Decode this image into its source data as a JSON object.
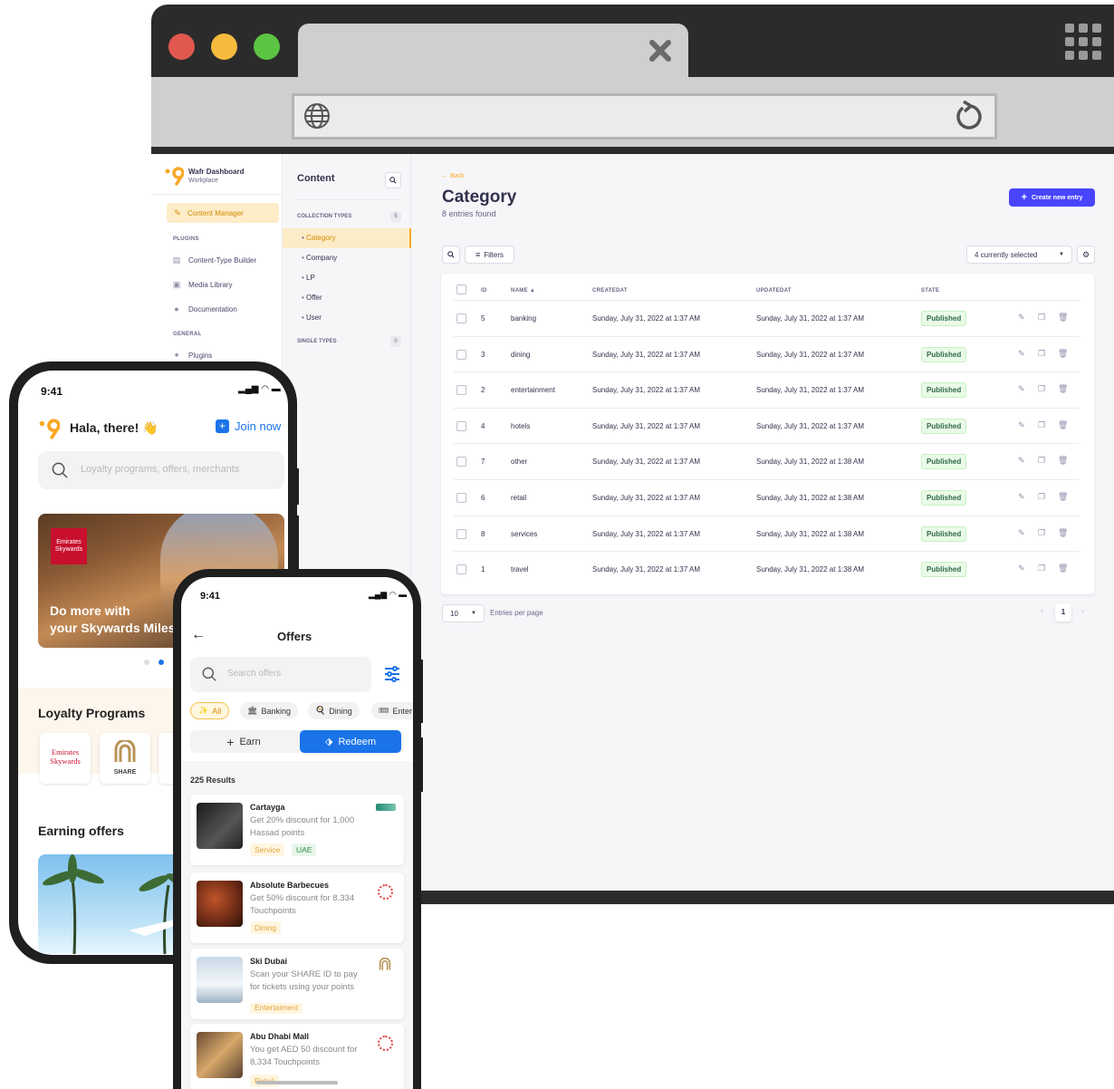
{
  "browser": {
    "address": ""
  },
  "cms": {
    "brand_title": "Wafr Dashboard",
    "brand_subtitle": "Workplace",
    "content_manager": "Content Manager",
    "plugins_heading": "PLUGINS",
    "plugins": [
      "Content-Type Builder",
      "Media Library",
      "Documentation"
    ],
    "general_heading": "GENERAL",
    "general": [
      "Plugins"
    ],
    "subnav_title": "Content",
    "collection_types_label": "COLLECTION TYPES",
    "collection_types_count": "5",
    "collection_types": [
      "Category",
      "Company",
      "LP",
      "Offer",
      "User"
    ],
    "single_types_label": "SINGLE TYPES",
    "single_types_count": "0",
    "back": "Back",
    "page_title": "Category",
    "entries_found": "8 entries found",
    "create_button": "Create new entry",
    "filters": "Filters",
    "selected": "4 currently selected",
    "columns": [
      "ID",
      "NAME",
      "CREATEDAT",
      "UPDATEDAT",
      "STATE"
    ],
    "rows": [
      {
        "id": "5",
        "name": "banking",
        "created": "Sunday, July 31, 2022 at 1:37 AM",
        "updated": "Sunday, July 31, 2022 at 1:37 AM",
        "state": "Published"
      },
      {
        "id": "3",
        "name": "dining",
        "created": "Sunday, July 31, 2022 at 1:37 AM",
        "updated": "Sunday, July 31, 2022 at 1:37 AM",
        "state": "Published"
      },
      {
        "id": "2",
        "name": "entertainment",
        "created": "Sunday, July 31, 2022 at 1:37 AM",
        "updated": "Sunday, July 31, 2022 at 1:37 AM",
        "state": "Published"
      },
      {
        "id": "4",
        "name": "hotels",
        "created": "Sunday, July 31, 2022 at 1:37 AM",
        "updated": "Sunday, July 31, 2022 at 1:37 AM",
        "state": "Published"
      },
      {
        "id": "7",
        "name": "other",
        "created": "Sunday, July 31, 2022 at 1:37 AM",
        "updated": "Sunday, July 31, 2022 at 1:38 AM",
        "state": "Published"
      },
      {
        "id": "6",
        "name": "retail",
        "created": "Sunday, July 31, 2022 at 1:37 AM",
        "updated": "Sunday, July 31, 2022 at 1:38 AM",
        "state": "Published"
      },
      {
        "id": "8",
        "name": "services",
        "created": "Sunday, July 31, 2022 at 1:37 AM",
        "updated": "Sunday, July 31, 2022 at 1:38 AM",
        "state": "Published"
      },
      {
        "id": "1",
        "name": "travel",
        "created": "Sunday, July 31, 2022 at 1:37 AM",
        "updated": "Sunday, July 31, 2022 at 1:38 AM",
        "state": "Published"
      }
    ],
    "page_size": "10",
    "entries_per_page": "Entries per page",
    "current_page": "1"
  },
  "phone1": {
    "time": "9:41",
    "greeting": "Hala, there! 👋",
    "join": "Join now",
    "search_placeholder": "Loyalty programs, offers, merchants",
    "banner_line1": "Do more with",
    "banner_line2": "your Skywards Miles",
    "emirates_logo_text": "Emirates Skywards",
    "loyalty_heading": "Loyalty Programs",
    "share_logo_text": "SHARE",
    "earning_heading": "Earning offers"
  },
  "phone2": {
    "time": "9:41",
    "title": "Offers",
    "search_placeholder": "Search offers",
    "chips": [
      "All",
      "Banking",
      "Dining",
      "Enter"
    ],
    "earn": "Earn",
    "redeem": "Redeem",
    "results": "225 Results",
    "offers": [
      {
        "title": "Cartayga",
        "desc": "Get 20% discount for 1,000 Hassad points",
        "tags": [
          "Service",
          "UAE"
        ]
      },
      {
        "title": "Absolute Barbecues",
        "desc": "Get 50% discount for 8,334 Touchpoints",
        "tags": [
          "Dining"
        ]
      },
      {
        "title": "Ski Dubai",
        "desc": "Scan your SHARE ID to pay for tickets using your points",
        "tags": [
          "Entertaiment"
        ]
      },
      {
        "title": "Abu Dhabi Mall",
        "desc": "You get AED 50 discount for 8,334 Touchpoints",
        "tags": [
          "Retail"
        ]
      }
    ]
  },
  "colors": {
    "primary": "#4945ff",
    "accent": "#f9a825",
    "published_bg": "#eafbe7",
    "published_text": "#2f6846",
    "app_blue": "#1a73e8"
  }
}
